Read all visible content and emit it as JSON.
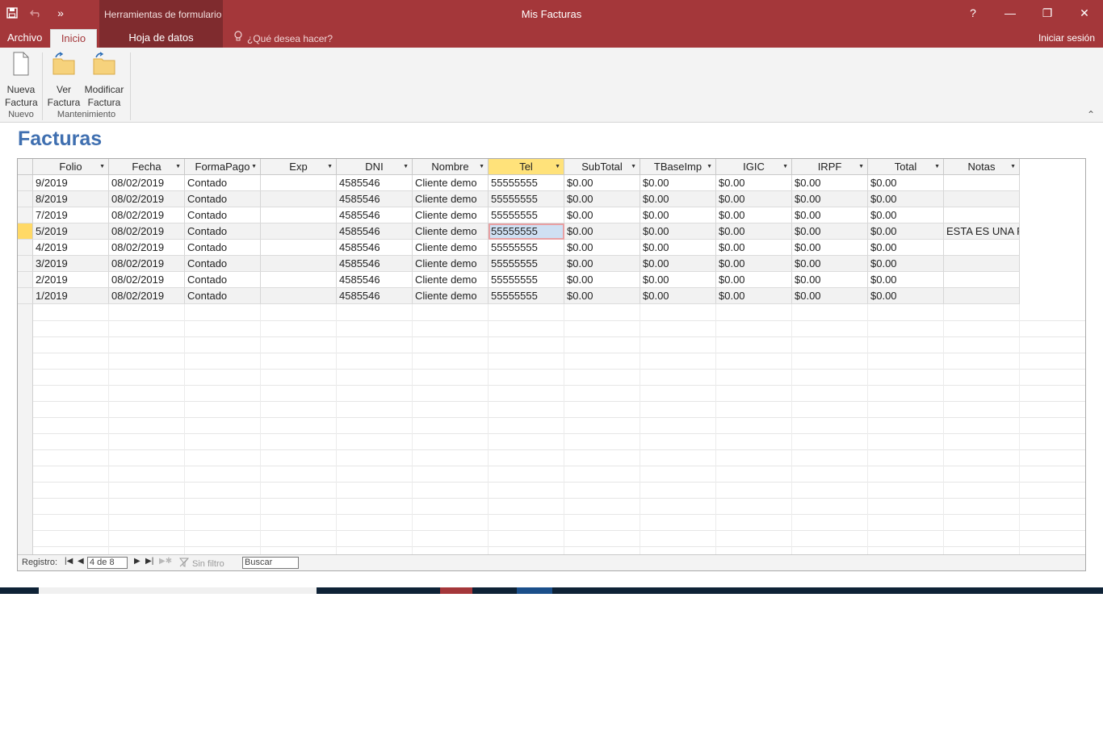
{
  "window": {
    "title": "Mis Facturas",
    "context_tools_label": "Herramientas de formulario",
    "help": "?",
    "minimize": "—",
    "restore": "❐",
    "close": "✕"
  },
  "qat": {
    "save_icon": "save-icon",
    "undo_icon": "undo-icon",
    "more": "»"
  },
  "tabs": {
    "archivo": "Archivo",
    "inicio": "Inicio",
    "hoja_datos": "Hoja de datos",
    "tell_me": "¿Qué desea hacer?",
    "sign_in": "Iniciar sesión"
  },
  "ribbon": {
    "nueva_factura_l1": "Nueva",
    "nueva_factura_l2": "Factura",
    "ver_factura_l1": "Ver",
    "ver_factura_l2": "Factura",
    "modificar_factura_l1": "Modificar",
    "modificar_factura_l2": "Factura",
    "group_nuevo": "Nuevo",
    "group_mantenimiento": "Mantenimiento",
    "collapse": "⌃"
  },
  "doc": {
    "title": "Facturas"
  },
  "table": {
    "columns": [
      "Folio",
      "Fecha",
      "FormaPago",
      "Exp",
      "DNI",
      "Nombre",
      "Tel",
      "SubTotal",
      "TBaseImp",
      "IGIC",
      "IRPF",
      "Total",
      "Notas"
    ],
    "rows": [
      [
        "9/2019",
        "08/02/2019",
        "Contado",
        "",
        "4585546",
        "Cliente demo",
        "55555555",
        "$0.00",
        "$0.00",
        "$0.00",
        "$0.00",
        "$0.00",
        ""
      ],
      [
        "8/2019",
        "08/02/2019",
        "Contado",
        "",
        "4585546",
        "Cliente demo",
        "55555555",
        "$0.00",
        "$0.00",
        "$0.00",
        "$0.00",
        "$0.00",
        ""
      ],
      [
        "7/2019",
        "08/02/2019",
        "Contado",
        "",
        "4585546",
        "Cliente demo",
        "55555555",
        "$0.00",
        "$0.00",
        "$0.00",
        "$0.00",
        "$0.00",
        ""
      ],
      [
        "5/2019",
        "08/02/2019",
        "Contado",
        "",
        "4585546",
        "Cliente demo",
        "55555555",
        "$0.00",
        "$0.00",
        "$0.00",
        "$0.00",
        "$0.00",
        "ESTA ES UNA P"
      ],
      [
        "4/2019",
        "08/02/2019",
        "Contado",
        "",
        "4585546",
        "Cliente demo",
        "55555555",
        "$0.00",
        "$0.00",
        "$0.00",
        "$0.00",
        "$0.00",
        ""
      ],
      [
        "3/2019",
        "08/02/2019",
        "Contado",
        "",
        "4585546",
        "Cliente demo",
        "55555555",
        "$0.00",
        "$0.00",
        "$0.00",
        "$0.00",
        "$0.00",
        ""
      ],
      [
        "2/2019",
        "08/02/2019",
        "Contado",
        "",
        "4585546",
        "Cliente demo",
        "55555555",
        "$0.00",
        "$0.00",
        "$0.00",
        "$0.00",
        "$0.00",
        ""
      ],
      [
        "1/2019",
        "08/02/2019",
        "Contado",
        "",
        "4585546",
        "Cliente demo",
        "55555555",
        "$0.00",
        "$0.00",
        "$0.00",
        "$0.00",
        "$0.00",
        ""
      ]
    ],
    "selected_column": "Tel",
    "current_row_index": 3
  },
  "navigation": {
    "label": "Registro:",
    "position": "4 de 8",
    "filter": "Sin filtro",
    "search": "Buscar"
  },
  "colors": {
    "accent": "#a4373a",
    "title_blue": "#3f6fb0",
    "selected_header": "#ffe27a",
    "current_row": "#ffd966"
  }
}
